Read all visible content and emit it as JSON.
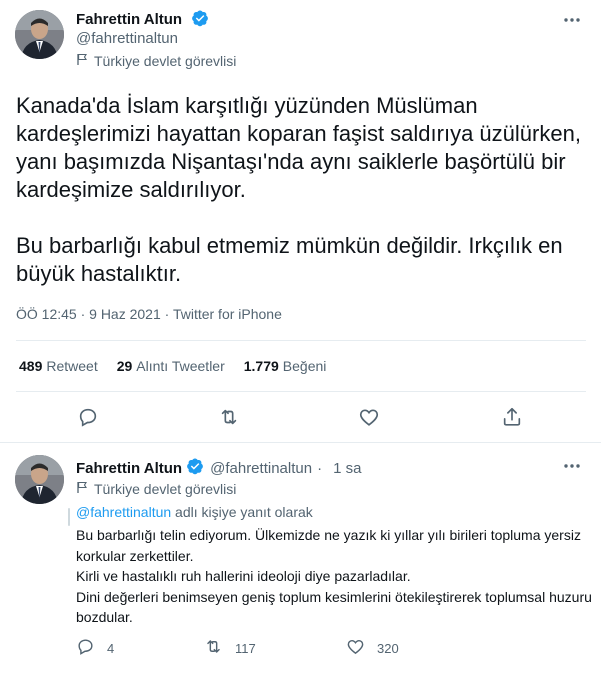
{
  "main_tweet": {
    "author_name": "Fahrettin Altun",
    "handle": "@fahrettinaltun",
    "account_label": "Türkiye devlet görevlisi",
    "text": "Kanada'da İslam karşıtlığı yüzünden Müslüman kardeşlerimizi hayattan koparan faşist saldırıya üzülürken, yanı başımızda Nişantaşı'nda aynı saiklerle başörtülü bir kardeşimize saldırılıyor.\n\nBu barbarlığı kabul etmemiz mümkün değildir. Irkçılık en büyük hastalıktır.",
    "meta": "ÖÖ 12:45 · 9 Haz 2021 · Twitter for iPhone",
    "stats": {
      "retweets_count": "489",
      "retweets_label": "Retweet",
      "quotes_count": "29",
      "quotes_label": "Alıntı Tweetler",
      "likes_count": "1.779",
      "likes_label": "Beğeni"
    }
  },
  "reply_tweet": {
    "author_name": "Fahrettin Altun",
    "handle": "@fahrettinaltun",
    "separator": "·",
    "time": "1 sa",
    "account_label": "Türkiye devlet görevlisi",
    "replying_to_mention": "@fahrettinaltun",
    "replying_to_suffix": " adlı kişiye yanıt olarak",
    "text": "Bu barbarlığı telin ediyorum. Ülkemizde ne yazık ki yıllar yılı birileri topluma yersiz korkular zerkettiler.\nKirli ve hastalıklı ruh hallerini ideoloji diye pazarladılar.\nDini değerleri benimseyen geniş toplum kesimlerini ötekileştirerek toplumsal huzuru bozdular.",
    "reply_count": "4",
    "retweet_count": "117",
    "like_count": "320"
  },
  "colors": {
    "verified": "#1d9bf0",
    "secondary_text": "#536471",
    "divider": "#e6ecf0"
  },
  "icons": [
    "verified-badge-icon",
    "flag-icon",
    "more-icon",
    "reply-icon",
    "retweet-icon",
    "like-icon",
    "share-icon"
  ]
}
